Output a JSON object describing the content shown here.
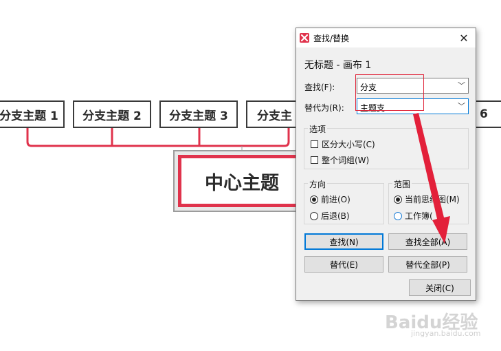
{
  "mindmap": {
    "branches": [
      "分支主题 1",
      "分支主题 2",
      "分支主题 3",
      "分支主",
      "6"
    ],
    "center": "中心主题",
    "colors": {
      "accent": "#e0334c",
      "border": "#3a3a3a"
    }
  },
  "dialog": {
    "title": "查找/替换",
    "close_icon": "close-icon",
    "doc_title": "无标题 - 画布 1",
    "find_label": "查找(F):",
    "find_value": "分支",
    "replace_label": "替代为(R):",
    "replace_value": "主题支",
    "options_title": "选项",
    "match_case": "区分大小写(C)",
    "whole_word": "整个词组(W)",
    "direction_title": "方向",
    "forward": "前进(O)",
    "backward": "后退(B)",
    "scope_title": "范围",
    "current_map": "当前思维图(M)",
    "workbook": "工作簿(",
    "btn_find": "查找(N)",
    "btn_find_all": "查找全部(A)",
    "btn_replace": "替代(E)",
    "btn_replace_all": "替代全部(P)",
    "btn_close": "关闭(C)"
  },
  "watermark": {
    "brand": "Baidu经验",
    "url": "jingyan.baidu.com"
  }
}
